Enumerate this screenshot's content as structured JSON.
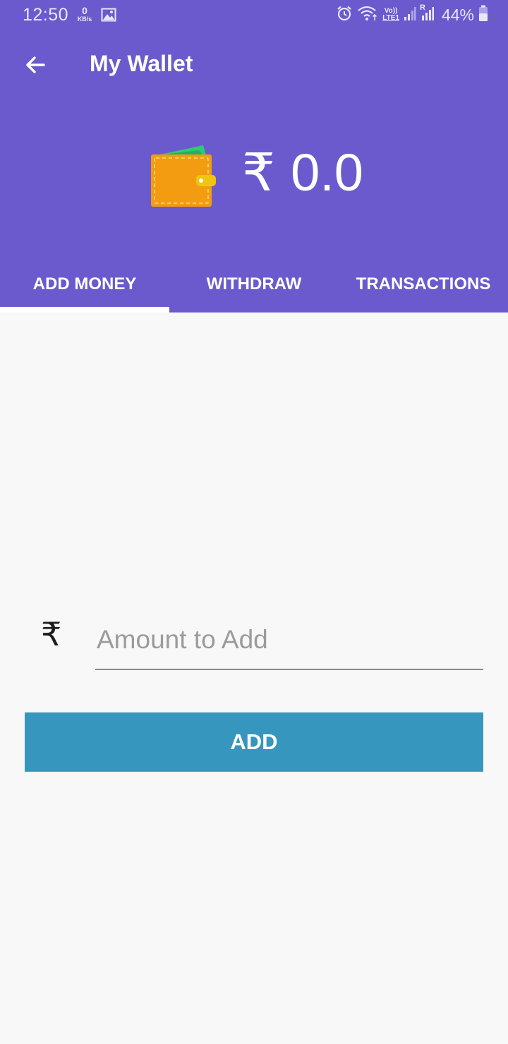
{
  "status_bar": {
    "time": "12:50",
    "net_speed_value": "0",
    "net_speed_unit": "KB/s",
    "network_volte": "Vo))",
    "network_lte": "LTE1",
    "roaming": "R",
    "battery": "44%",
    "icons": [
      "image-icon",
      "alarm-icon",
      "wifi-icon",
      "signal-icon",
      "signal-roaming-icon",
      "battery-icon"
    ]
  },
  "toolbar": {
    "title": "My Wallet",
    "back_icon": "back-arrow-icon"
  },
  "balance": {
    "currency": "₹",
    "amount": "0.0",
    "icon": "wallet-icon"
  },
  "tabs": [
    {
      "label": "ADD MONEY",
      "active": true
    },
    {
      "label": "WITHDRAW",
      "active": false
    },
    {
      "label": "TRANSACTIONS",
      "active": false
    }
  ],
  "form": {
    "prefix": "₹",
    "amount_placeholder": "Amount to Add",
    "amount_value": "",
    "add_label": "ADD"
  },
  "colors": {
    "header": "#6a5acd",
    "button": "#3796bd",
    "background": "#f8f8f8",
    "wallet": "#f39c12"
  }
}
